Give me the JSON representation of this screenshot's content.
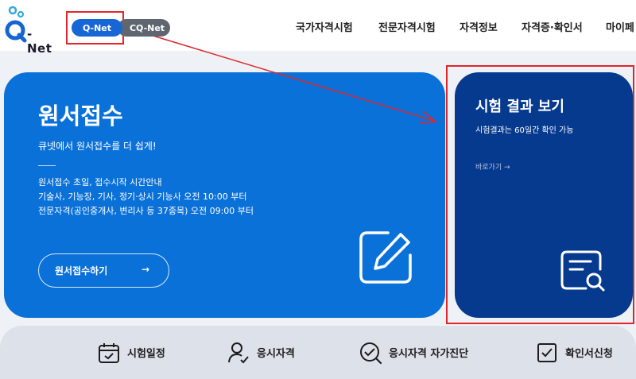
{
  "header": {
    "logo_text": "- Net",
    "site_tabs": [
      "Q-Net",
      "CQ-Net"
    ],
    "nav": [
      "국가자격시험",
      "전문자격시험",
      "자격정보",
      "자격증·확인서",
      "마이페"
    ]
  },
  "apply_card": {
    "title": "원서접수",
    "subtitle": "큐넷에서 원서접수를 더 쉽게!",
    "notes": [
      "원서접수 초일, 접수시작 시간안내",
      "기술사, 기능장, 기사, 정기·상시 기능사 오전 10:00 부터",
      "전문자격(공인중개사, 변리사 등 37종목) 오전 09:00 부터"
    ],
    "button_label": "원서접수하기",
    "button_arrow": "→",
    "icon": "edit-icon"
  },
  "result_card": {
    "title": "시험 결과 보기",
    "subtitle": "시험결과는 60일간 확인 가능",
    "link_label": "바로가기 →",
    "icon": "document-search-icon"
  },
  "quick_menu": [
    {
      "label": "시험일정",
      "icon": "calendar-check-icon"
    },
    {
      "label": "응시자격",
      "icon": "person-check-icon"
    },
    {
      "label": "응시자격 자가진단",
      "icon": "search-check-icon"
    },
    {
      "label": "확인서신청",
      "icon": "checkbox-icon"
    }
  ],
  "annotation": {
    "color": "#e0262a"
  },
  "colors": {
    "brand_blue": "#0a71d9",
    "dark_blue": "#063a8f",
    "active_pill": "#1766d6"
  }
}
